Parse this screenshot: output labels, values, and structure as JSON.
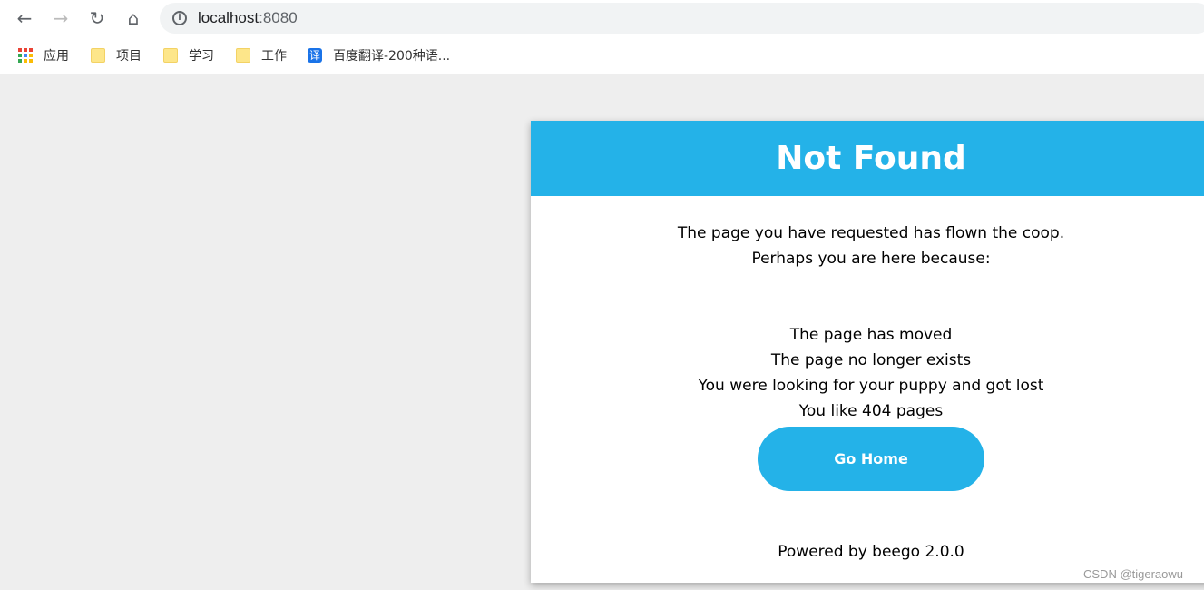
{
  "browser": {
    "url_host": "localhost",
    "url_port": ":8080",
    "bookmarks": [
      {
        "label": "应用",
        "icon": "apps-grid-icon"
      },
      {
        "label": "项目",
        "icon": "folder-icon"
      },
      {
        "label": "学习",
        "icon": "folder-icon"
      },
      {
        "label": "工作",
        "icon": "folder-icon"
      },
      {
        "label": "百度翻译-200种语...",
        "icon": "translate-icon",
        "icon_text": "译"
      }
    ]
  },
  "page": {
    "title": "Not Found",
    "intro": [
      "The page you have requested has flown the coop.",
      "Perhaps you are here because:"
    ],
    "reasons": [
      "The page has moved",
      "The page no longer exists",
      "You were looking for your puppy and got lost",
      "You like 404 pages"
    ],
    "button_label": "Go Home",
    "powered_by": "Powered by beego 2.0.0",
    "accent_color": "#24b2e8"
  },
  "watermark": "CSDN @tigeraowu"
}
